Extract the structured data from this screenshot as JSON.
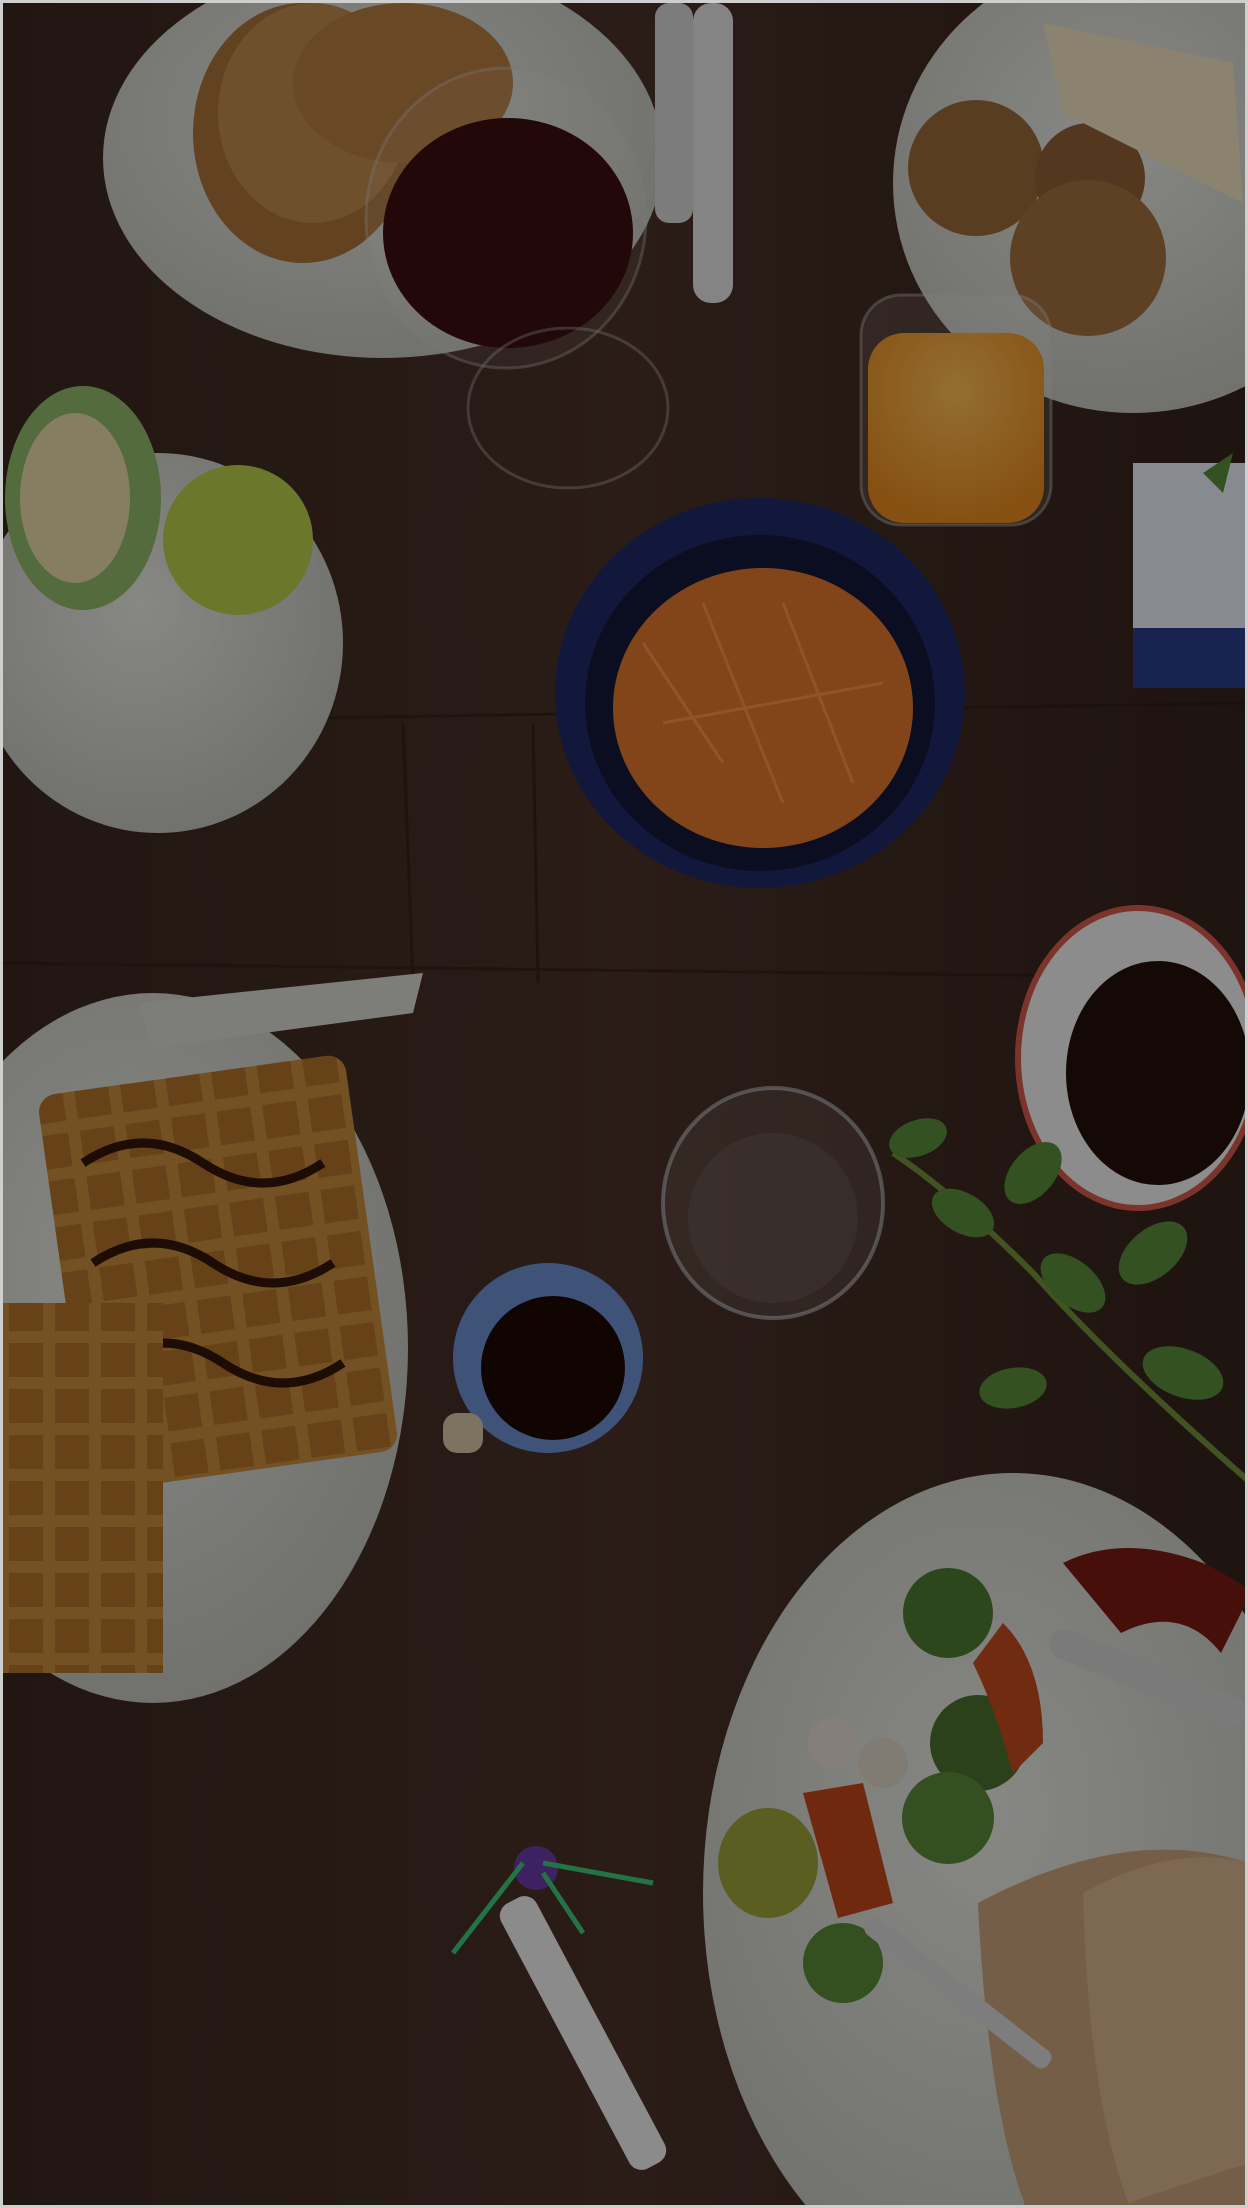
{
  "screen": {
    "description_free": true,
    "palette": {
      "table": "#3a2720",
      "table_dark": "#2a1c16",
      "plate": "#cfcfc9",
      "plate_rim": "#e6e6df",
      "wine": "#3b0f10",
      "juice": "#f2a13a",
      "carrot": "#e0782b",
      "bowl_blue": "#1e2a66",
      "leaf": "#5a8c3a",
      "waffle": "#c88a3a",
      "chocolate": "#2b1208",
      "bread": "#c9a27a",
      "tomato_sauce": "#7a1a12"
    },
    "overlay_opacity": 0.42
  }
}
